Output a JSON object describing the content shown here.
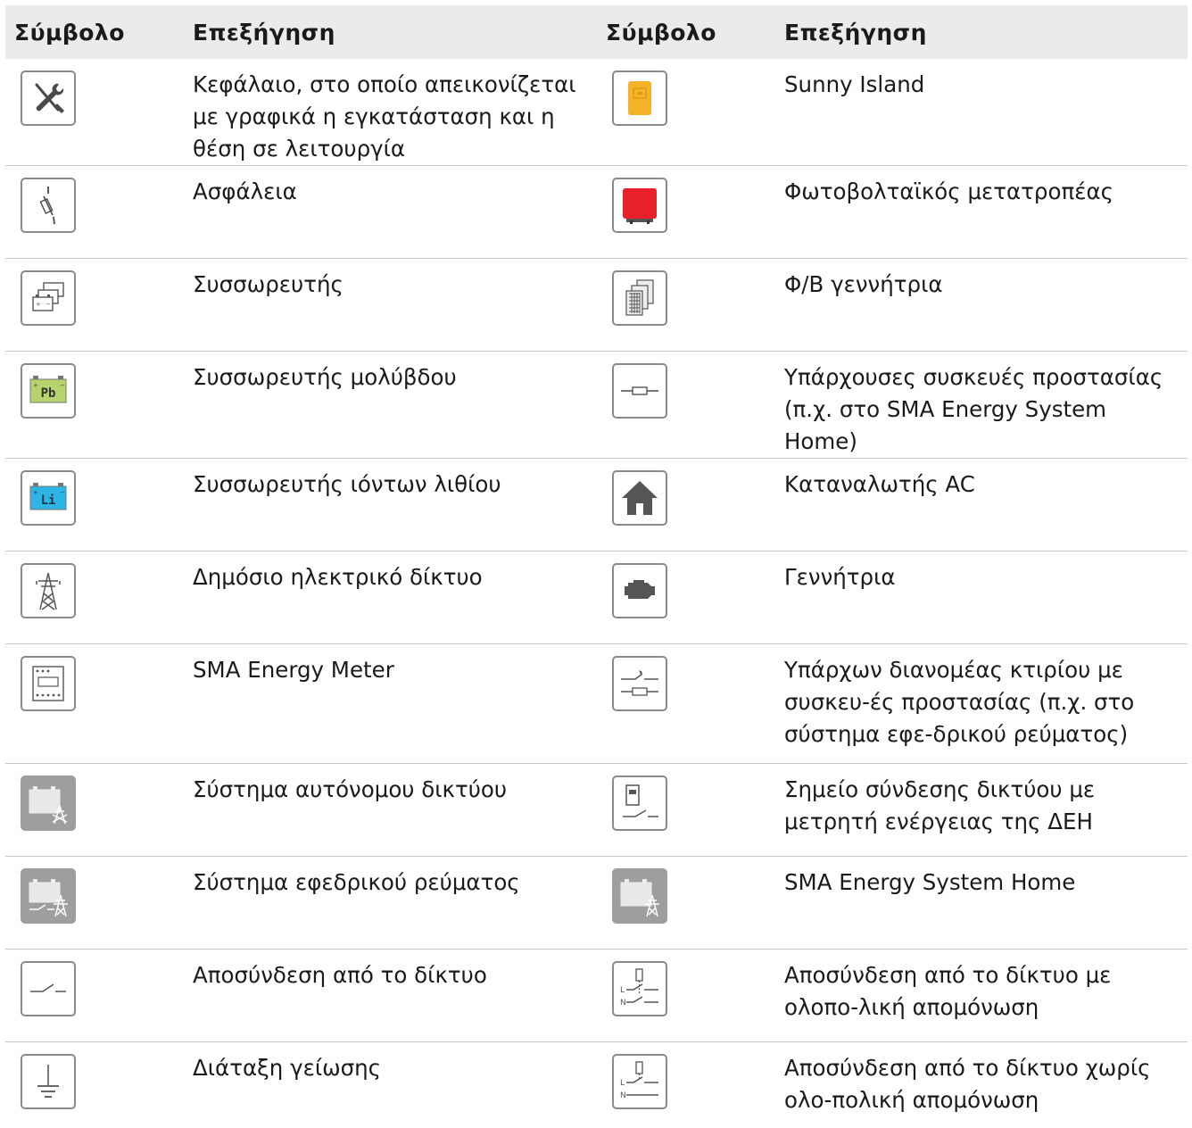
{
  "header": {
    "symbol_col": "Σύμβολο",
    "explanation_col": "Επεξήγηση"
  },
  "rows": [
    {
      "left": {
        "icon": "tools-icon",
        "text": "Κεφάλαιο, στο οποίο απεικονίζεται με γραφικά η εγκατάσταση και η θέση σε λειτουργία"
      },
      "right": {
        "icon": "sunny-island-icon",
        "text": "Sunny Island"
      }
    },
    {
      "left": {
        "icon": "fuse-icon",
        "text": "Ασφάλεια"
      },
      "right": {
        "icon": "pv-inverter-icon",
        "text": "Φωτοβολταϊκός μετατροπέας"
      }
    },
    {
      "left": {
        "icon": "battery-bank-icon",
        "text": "Συσσωρευτής"
      },
      "right": {
        "icon": "pv-array-icon",
        "text": "Φ/Β γεννήτρια"
      }
    },
    {
      "left": {
        "icon": "lead-battery-icon",
        "icon_label": "Pb",
        "text": "Συσσωρευτής μολύβδου"
      },
      "right": {
        "icon": "protective-device-icon",
        "text": "Υπάρχουσες συσκευές προστασίας (π.χ. στο SMA Energy System Home)"
      }
    },
    {
      "left": {
        "icon": "lithium-battery-icon",
        "icon_label": "Li",
        "text": "Συσσωρευτής ιόντων λιθίου"
      },
      "right": {
        "icon": "house-icon",
        "text": "Καταναλωτής AC"
      }
    },
    {
      "left": {
        "icon": "utility-grid-icon",
        "text": "Δημόσιο ηλεκτρικό δίκτυο"
      },
      "right": {
        "icon": "generator-icon",
        "text": "Γεννήτρια"
      }
    },
    {
      "left": {
        "icon": "energy-meter-icon",
        "text": "SMA Energy Meter"
      },
      "right": {
        "icon": "distribution-board-icon",
        "text": "Υπάρχων διανομέας κτιρίου με συσκευ-ές προστασίας (π.χ. στο σύστημα εφε-δρικού ρεύματος)"
      }
    },
    {
      "left": {
        "icon": "off-grid-system-icon",
        "text": "Σύστημα αυτόνομου δικτύου"
      },
      "right": {
        "icon": "grid-connection-meter-icon",
        "text": "Σημείο σύνδεσης δικτύου με μετρητή ενέργειας της ΔΕΗ"
      }
    },
    {
      "left": {
        "icon": "backup-system-icon",
        "text": "Σύστημα εφεδρικού ρεύματος"
      },
      "right": {
        "icon": "energy-system-home-icon",
        "text": "SMA Energy System Home"
      }
    },
    {
      "left": {
        "icon": "grid-disconnect-icon",
        "text": "Αποσύνδεση από το δίκτυο"
      },
      "right": {
        "icon": "all-pole-disconnect-icon",
        "icon_label_l": "L",
        "icon_label_n": "N",
        "text": "Αποσύνδεση από το δίκτυο με ολοπο-λική απομόνωση"
      }
    },
    {
      "left": {
        "icon": "grounding-icon",
        "text": "Διάταξη γείωσης"
      },
      "right": {
        "icon": "non-all-pole-disconnect-icon",
        "icon_label_l": "L",
        "icon_label_n": "N",
        "text": "Αποσύνδεση από το δίκτυο χωρίς ολο-πολική απομόνωση"
      }
    }
  ],
  "colors": {
    "header_bg": "#ebebeb",
    "icon_border": "#8a8a8a",
    "icon_gray": "#9e9e9e",
    "sunny_island_yellow": "#f5b32a",
    "inverter_red": "#e8202a",
    "lead_green": "#b7d36e",
    "lithium_blue": "#2eb5e6"
  }
}
